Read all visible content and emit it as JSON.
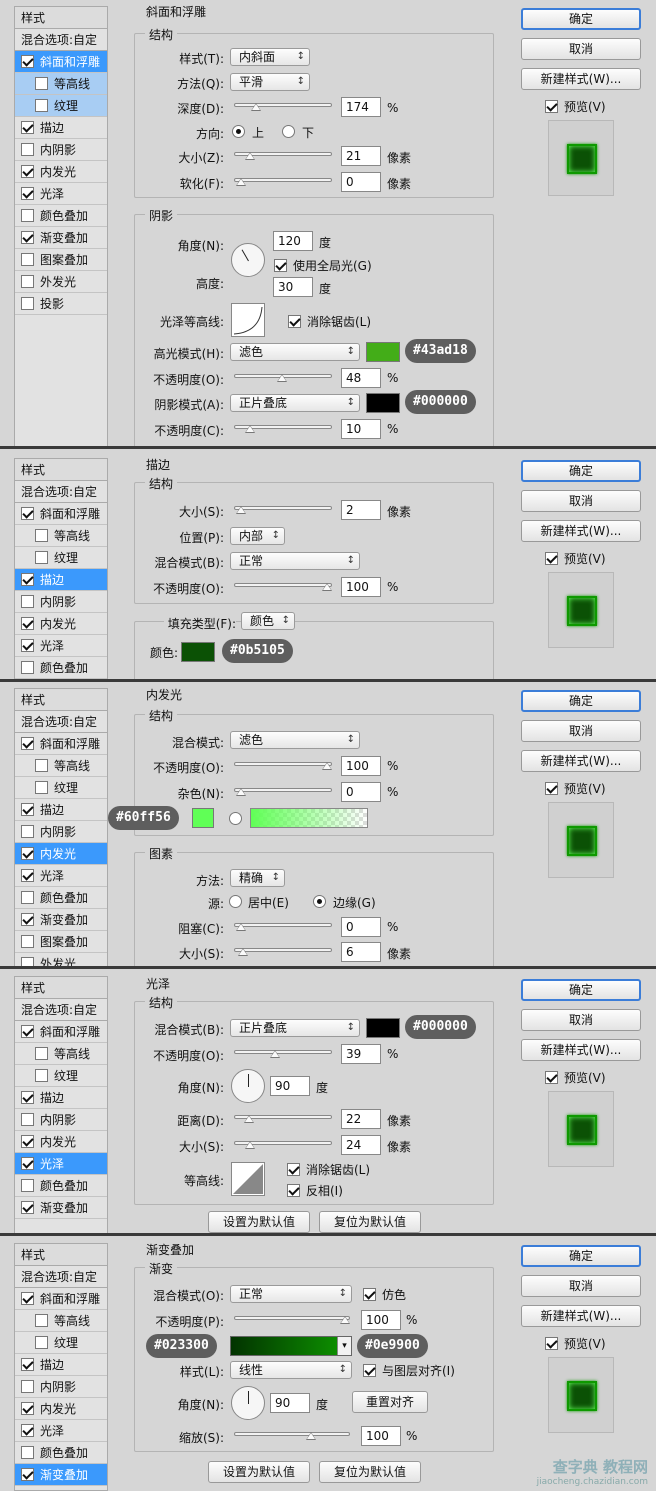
{
  "panels": [
    {
      "sidebar": {
        "header": "样式",
        "blend": "混合选项:自定",
        "items": [
          {
            "label": "斜面和浮雕",
            "checked": true,
            "sub": false,
            "state": "sel"
          },
          {
            "label": "等高线",
            "checked": false,
            "sub": true,
            "state": "subsel"
          },
          {
            "label": "纹理",
            "checked": false,
            "sub": true,
            "state": "subsel"
          },
          {
            "label": "描边",
            "checked": true,
            "sub": false,
            "state": ""
          },
          {
            "label": "内阴影",
            "checked": false,
            "sub": false,
            "state": ""
          },
          {
            "label": "内发光",
            "checked": true,
            "sub": false,
            "state": ""
          },
          {
            "label": "光泽",
            "checked": true,
            "sub": false,
            "state": ""
          },
          {
            "label": "颜色叠加",
            "checked": false,
            "sub": false,
            "state": ""
          },
          {
            "label": "渐变叠加",
            "checked": true,
            "sub": false,
            "state": ""
          },
          {
            "label": "图案叠加",
            "checked": false,
            "sub": false,
            "state": ""
          },
          {
            "label": "外发光",
            "checked": false,
            "sub": false,
            "state": ""
          },
          {
            "label": "投影",
            "checked": false,
            "sub": false,
            "state": ""
          }
        ]
      },
      "section_title": "斜面和浮雕",
      "group1_title": "结构",
      "style_label": "样式(T):",
      "style_value": "内斜面",
      "technique_label": "方法(Q):",
      "technique_value": "平滑",
      "depth_label": "深度(D):",
      "depth_value": "174",
      "depth_unit": "%",
      "depth_level": 0.17,
      "direction_label": "方向:",
      "dir_up": "上",
      "dir_down": "下",
      "size_label": "大小(Z):",
      "size_value": "21",
      "size_unit": "像素",
      "size_level": 0.1,
      "soften_label": "软化(F):",
      "soften_value": "0",
      "soften_unit": "像素",
      "soften_level": 0.0,
      "group2_title": "阴影",
      "angle_label": "角度(N):",
      "angle_value": "120",
      "angle_unit": "度",
      "global_light": "使用全局光(G)",
      "altitude_label": "高度:",
      "altitude_value": "30",
      "altitude_unit": "度",
      "gloss_label": "光泽等高线:",
      "antialias": "消除锯齿(L)",
      "hl_mode_label": "高光模式(H):",
      "hl_mode": "滤色",
      "hl_color": "#43ad18",
      "hl_hex": "#43ad18",
      "hl_opacity_label": "不透明度(O):",
      "hl_opacity": "48",
      "hl_opacity_level": 0.48,
      "sh_mode_label": "阴影模式(A):",
      "sh_mode": "正片叠底",
      "sh_color": "#000000",
      "sh_hex": "#000000",
      "sh_opacity_label": "不透明度(C):",
      "sh_opacity": "10",
      "sh_opacity_level": 0.1,
      "pct": "%"
    },
    {
      "sidebar": {
        "header": "样式",
        "blend": "混合选项:自定",
        "items": [
          {
            "label": "斜面和浮雕",
            "checked": true,
            "sub": false,
            "state": ""
          },
          {
            "label": "等高线",
            "checked": false,
            "sub": true,
            "state": ""
          },
          {
            "label": "纹理",
            "checked": false,
            "sub": true,
            "state": ""
          },
          {
            "label": "描边",
            "checked": true,
            "sub": false,
            "state": "sel"
          },
          {
            "label": "内阴影",
            "checked": false,
            "sub": false,
            "state": ""
          },
          {
            "label": "内发光",
            "checked": true,
            "sub": false,
            "state": ""
          },
          {
            "label": "光泽",
            "checked": true,
            "sub": false,
            "state": ""
          },
          {
            "label": "颜色叠加",
            "checked": false,
            "sub": false,
            "state": ""
          }
        ]
      },
      "section_title": "描边",
      "group1_title": "结构",
      "size_label": "大小(S):",
      "size_value": "2",
      "size_unit": "像素",
      "size_level": 0.0,
      "position_label": "位置(P):",
      "position_value": "内部",
      "blend_label": "混合模式(B):",
      "blend_value": "正常",
      "opacity_label": "不透明度(O):",
      "opacity_value": "100",
      "opacity_unit": "%",
      "opacity_level": 1.0,
      "fill_label": "填充类型(F):",
      "fill_value": "颜色",
      "color_label": "颜色:",
      "color": "#0b5105",
      "color_hex": "#0b5105"
    },
    {
      "sidebar": {
        "header": "样式",
        "blend": "混合选项:自定",
        "items": [
          {
            "label": "斜面和浮雕",
            "checked": true,
            "sub": false,
            "state": ""
          },
          {
            "label": "等高线",
            "checked": false,
            "sub": true,
            "state": ""
          },
          {
            "label": "纹理",
            "checked": false,
            "sub": true,
            "state": ""
          },
          {
            "label": "描边",
            "checked": true,
            "sub": false,
            "state": ""
          },
          {
            "label": "内阴影",
            "checked": false,
            "sub": false,
            "state": ""
          },
          {
            "label": "内发光",
            "checked": true,
            "sub": false,
            "state": "sel"
          },
          {
            "label": "光泽",
            "checked": true,
            "sub": false,
            "state": ""
          },
          {
            "label": "颜色叠加",
            "checked": false,
            "sub": false,
            "state": ""
          },
          {
            "label": "渐变叠加",
            "checked": true,
            "sub": false,
            "state": ""
          },
          {
            "label": "图案叠加",
            "checked": false,
            "sub": false,
            "state": ""
          },
          {
            "label": "外发光",
            "checked": false,
            "sub": false,
            "state": ""
          }
        ]
      },
      "section_title": "内发光",
      "group1_title": "结构",
      "blend_label": "混合模式:",
      "blend_value": "滤色",
      "opacity_label": "不透明度(O):",
      "opacity_value": "100",
      "opacity_unit": "%",
      "opacity_level": 1.0,
      "noise_label": "杂色(N):",
      "noise_value": "0",
      "noise_unit": "%",
      "noise_level": 0.0,
      "glow_color": "#60ff56",
      "glow_hex": "#60ff56",
      "group2_title": "图素",
      "technique_label": "方法:",
      "technique_value": "精确",
      "source_label": "源:",
      "src_center": "居中(E)",
      "src_edge": "边缘(G)",
      "choke_label": "阻塞(C):",
      "choke_value": "0",
      "choke_unit": "%",
      "choke_level": 0.0,
      "size_label": "大小(S):",
      "size_value": "6",
      "size_unit": "像素",
      "size_level": 0.02
    },
    {
      "sidebar": {
        "header": "样式",
        "blend": "混合选项:自定",
        "items": [
          {
            "label": "斜面和浮雕",
            "checked": true,
            "sub": false,
            "state": ""
          },
          {
            "label": "等高线",
            "checked": false,
            "sub": true,
            "state": ""
          },
          {
            "label": "纹理",
            "checked": false,
            "sub": true,
            "state": ""
          },
          {
            "label": "描边",
            "checked": true,
            "sub": false,
            "state": ""
          },
          {
            "label": "内阴影",
            "checked": false,
            "sub": false,
            "state": ""
          },
          {
            "label": "内发光",
            "checked": true,
            "sub": false,
            "state": ""
          },
          {
            "label": "光泽",
            "checked": true,
            "sub": false,
            "state": "sel"
          },
          {
            "label": "颜色叠加",
            "checked": false,
            "sub": false,
            "state": ""
          },
          {
            "label": "渐变叠加",
            "checked": true,
            "sub": false,
            "state": ""
          }
        ]
      },
      "section_title": "光泽",
      "group1_title": "结构",
      "blend_label": "混合模式(B):",
      "blend_value": "正片叠底",
      "color": "#000000",
      "color_hex": "#000000",
      "opacity_label": "不透明度(O):",
      "opacity_value": "39",
      "opacity_unit": "%",
      "opacity_level": 0.39,
      "angle_label": "角度(N):",
      "angle_value": "90",
      "angle_unit": "度",
      "distance_label": "距离(D):",
      "distance_value": "22",
      "distance_unit": "像素",
      "distance_level": 0.09,
      "size_label": "大小(S):",
      "size_value": "24",
      "size_unit": "像素",
      "size_level": 0.1,
      "contour_label": "等高线:",
      "antialias": "消除锯齿(L)",
      "invert": "反相(I)",
      "make_default": "设置为默认值",
      "reset_default": "复位为默认值"
    },
    {
      "sidebar": {
        "header": "样式",
        "blend": "混合选项:自定",
        "items": [
          {
            "label": "斜面和浮雕",
            "checked": true,
            "sub": false,
            "state": ""
          },
          {
            "label": "等高线",
            "checked": false,
            "sub": true,
            "state": ""
          },
          {
            "label": "纹理",
            "checked": false,
            "sub": true,
            "state": ""
          },
          {
            "label": "描边",
            "checked": true,
            "sub": false,
            "state": ""
          },
          {
            "label": "内阴影",
            "checked": false,
            "sub": false,
            "state": ""
          },
          {
            "label": "内发光",
            "checked": true,
            "sub": false,
            "state": ""
          },
          {
            "label": "光泽",
            "checked": true,
            "sub": false,
            "state": ""
          },
          {
            "label": "颜色叠加",
            "checked": false,
            "sub": false,
            "state": ""
          },
          {
            "label": "渐变叠加",
            "checked": true,
            "sub": false,
            "state": "sel"
          }
        ]
      },
      "section_title": "渐变叠加",
      "group1_title": "渐变",
      "blend_label": "混合模式(O):",
      "blend_value": "正常",
      "dither": "仿色",
      "opacity_label": "不透明度(P):",
      "opacity_value": "100",
      "opacity_unit": "%",
      "opacity_level": 1.0,
      "grad_from": "#023300",
      "grad_to": "#0e9900",
      "style_label": "样式(L):",
      "style_value": "线性",
      "align": "与图层对齐(I)",
      "angle_label": "角度(N):",
      "angle_value": "90",
      "angle_unit": "度",
      "reset_align": "重置对齐",
      "scale_label": "缩放(S):",
      "scale_value": "100",
      "scale_unit": "%",
      "scale_level": 0.67,
      "make_default": "设置为默认值",
      "reset_default": "复位为默认值"
    }
  ],
  "buttons": {
    "ok": "确定",
    "cancel": "取消",
    "new_style": "新建样式(W)...",
    "preview": "预览(V)"
  },
  "watermark": {
    "line1": "查字典 教程网",
    "line2": "jiaocheng.chazidian.com"
  }
}
